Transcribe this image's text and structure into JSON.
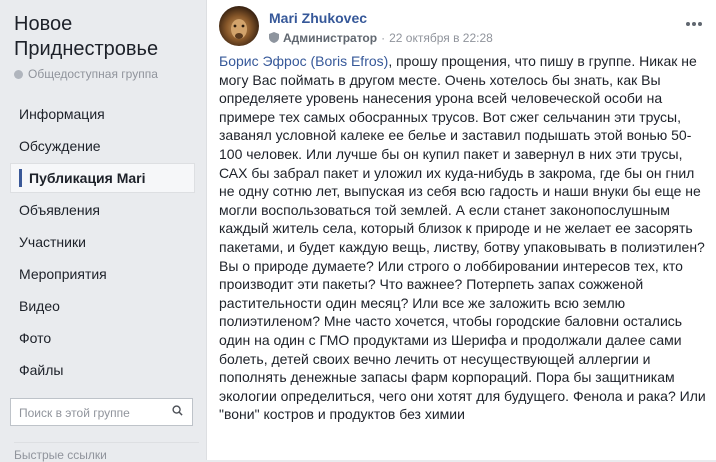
{
  "group": {
    "name": "Новое Приднестровье",
    "privacy": "Общедоступная группа"
  },
  "nav": {
    "items": [
      {
        "label": "Информация"
      },
      {
        "label": "Обсуждение"
      },
      {
        "label": "Публикация Mari",
        "active": true
      },
      {
        "label": "Объявления"
      },
      {
        "label": "Участники"
      },
      {
        "label": "Мероприятия"
      },
      {
        "label": "Видео"
      },
      {
        "label": "Фото"
      },
      {
        "label": "Файлы"
      }
    ]
  },
  "search": {
    "placeholder": "Поиск в этой группе"
  },
  "quick_links": "Быстрые ссылки",
  "post": {
    "author": "Mari Zhukovec",
    "role": "Администратор",
    "date": "22 октября в 22:28",
    "mention": "Борис Эфрос (Boris Efros)",
    "text": ", прошу прощения, что пишу в группе. Никак не могу Вас поймать в другом месте. Очень хотелось бы знать, как Вы определяете уровень нанесения урона всей человеческой особи на примере тех самых обосранных трусов. Вот сжег сельчанин эти трусы, заванял условной калеке ее белье и заставил подышать этой вонью 50-100 человек. Или лучше бы он купил пакет и завернул в них эти трусы, САХ бы забрал пакет и уложил их куда-нибудь в закрома, где бы он гнил не одну сотню лет, выпуская из себя всю гадость и наши внуки бы еще не могли воспользоваться той землей. А если станет законопослушным каждый житель села, который близок к природе и не желает ее засорять пакетами, и будет каждую вещь, листву, ботву упаковывать в полиэтилен? Вы о природе думаете? Или строго о лоббировании интересов тех, кто производит эти пакеты? Что важнее? Потерпеть запах сожженой растительности один месяц? Или все же заложить всю землю полиэтиленом? Мне часто хочется, чтобы городские баловни остались один на один с ГМО продуктами из Шерифа и продолжали далее сами болеть, детей своих вечно лечить от несуществующей аллергии и пополнять денежные запасы фарм корпораций. Пора бы защитникам экологии определиться, чего они хотят для будущего. Фенола и рака? Или \"вони\" костров и продуктов без химии"
  },
  "colors": {
    "link": "#365899",
    "accent": "#3b5998",
    "background": "#e9ebee"
  }
}
